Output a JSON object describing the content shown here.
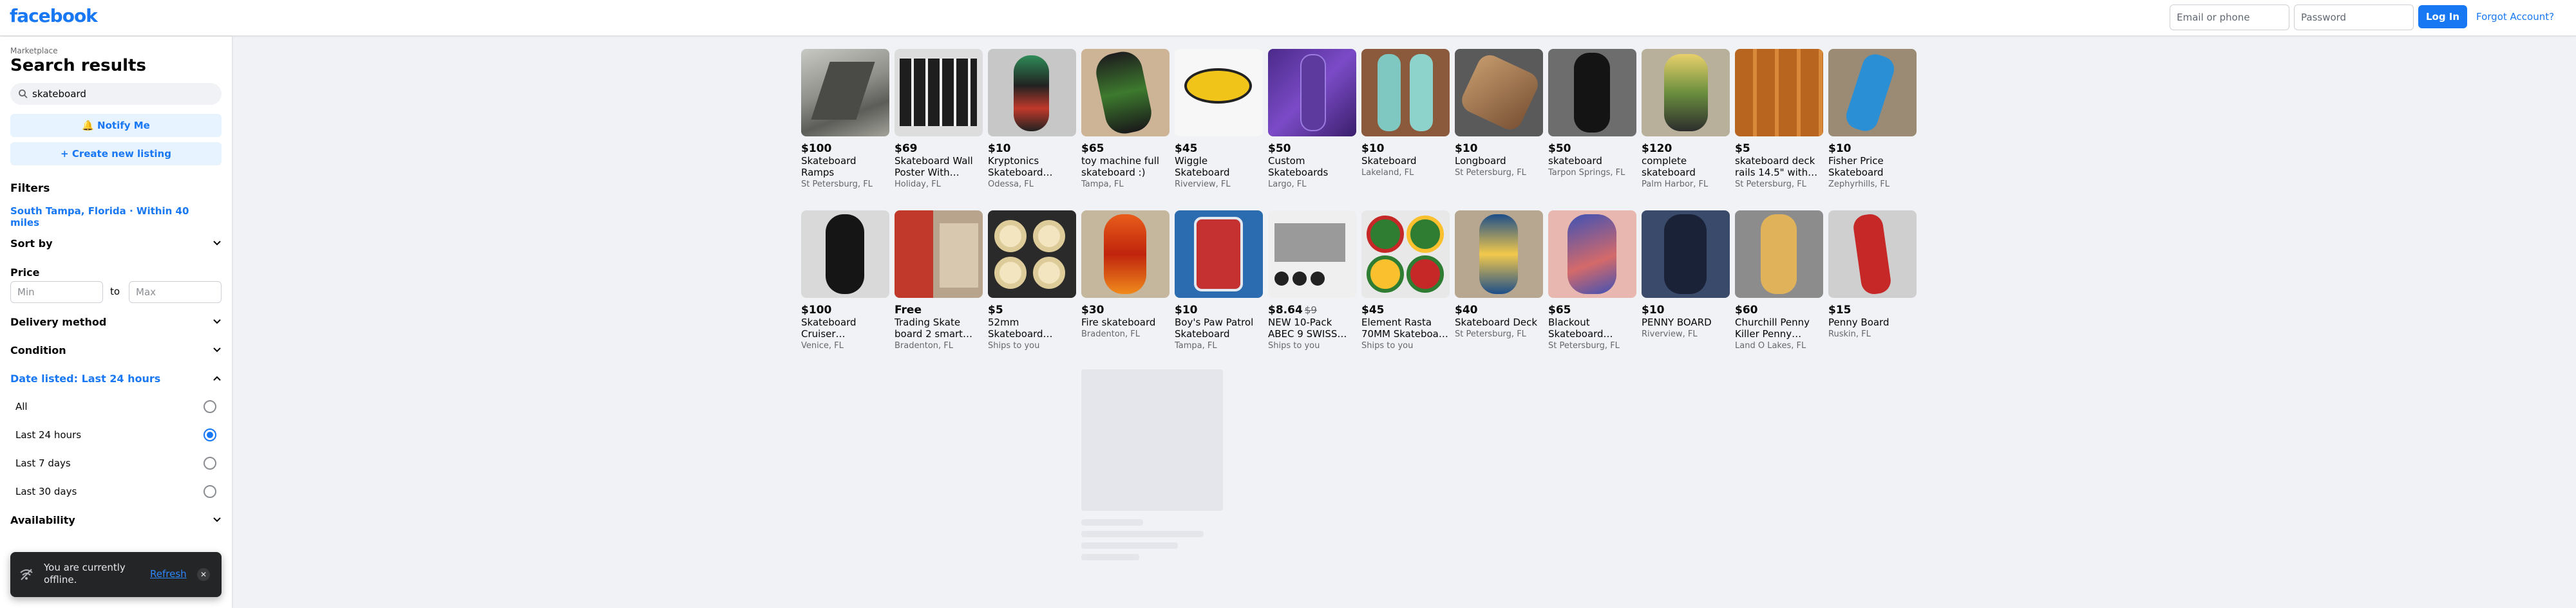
{
  "header": {
    "logo": "facebook",
    "email_placeholder": "Email or phone",
    "password_placeholder": "Password",
    "login_label": "Log In",
    "forgot_label": "Forgot Account?"
  },
  "sidebar": {
    "breadcrumb": "Marketplace",
    "title": "Search results",
    "search_value": "skateboard",
    "notify_label": "🔔 Notify Me",
    "create_label": "+ Create new listing",
    "filters_label": "Filters",
    "location": "South Tampa, Florida · Within 40 miles",
    "sort_label": "Sort by",
    "price_label": "Price",
    "min_placeholder": "Min",
    "to_label": "to",
    "max_placeholder": "Max",
    "delivery_label": "Delivery method",
    "condition_label": "Condition",
    "date_label": "Date listed: Last 24 hours",
    "date_options": [
      {
        "label": "All",
        "selected": false
      },
      {
        "label": "Last 24 hours",
        "selected": true
      },
      {
        "label": "Last 7 days",
        "selected": false
      },
      {
        "label": "Last 30 days",
        "selected": false
      }
    ],
    "availability_label": "Availability",
    "toast_message": "You are currently offline.",
    "toast_refresh": "Refresh",
    "toast_close": "✕"
  },
  "listings": [
    {
      "price": "$100",
      "name": "Skateboard Ramps",
      "location": "St Petersburg, FL"
    },
    {
      "price": "$69",
      "name": "Skateboard Wall Poster With…",
      "location": "Holiday, FL"
    },
    {
      "price": "$10",
      "name": "Kryptonics Skateboard…",
      "location": "Odessa, FL"
    },
    {
      "price": "$65",
      "name": "toy machine full skateboard :)",
      "location": "Tampa, FL"
    },
    {
      "price": "$45",
      "name": "Wiggle Skateboard",
      "location": "Riverview, FL"
    },
    {
      "price": "$50",
      "name": "Custom Skateboards",
      "location": "Largo, FL"
    },
    {
      "price": "$10",
      "name": "Skateboard",
      "location": "Lakeland, FL"
    },
    {
      "price": "$10",
      "name": "Longboard",
      "location": "St Petersburg, FL"
    },
    {
      "price": "$50",
      "name": "skateboard",
      "location": "Tarpon Springs, FL"
    },
    {
      "price": "$120",
      "name": "complete skateboard",
      "location": "Palm Harbor, FL"
    },
    {
      "price": "$5",
      "name": "skateboard deck rails 14.5\" with…",
      "location": "St Petersburg, FL"
    },
    {
      "price": "$10",
      "name": "Fisher Price Skateboard",
      "location": "Zephyrhills, FL"
    },
    {
      "price": "$100",
      "name": "Skateboard Cruiser…",
      "location": "Venice, FL"
    },
    {
      "price": "Free",
      "name": "Trading Skate board 2 smart…",
      "location": "Bradenton, FL"
    },
    {
      "price": "$5",
      "name": "52mm Skateboard…",
      "location": "Ships to you"
    },
    {
      "price": "$30",
      "name": "Fire skateboard",
      "location": "Bradenton, FL"
    },
    {
      "price": "$10",
      "name": "Boy's Paw Patrol Skateboard",
      "location": "Tampa, FL"
    },
    {
      "price": "$8.64",
      "old_price": "$9",
      "name": "NEW 10-Pack ABEC 9 SWISS…",
      "location": "Ships to you"
    },
    {
      "price": "$45",
      "name": "Element Rasta 70MM Skateboa…",
      "location": "Ships to you"
    },
    {
      "price": "$40",
      "name": "Skateboard Deck",
      "location": "St Petersburg, FL"
    },
    {
      "price": "$65",
      "name": "Blackout Skateboard…",
      "location": "St Petersburg, FL"
    },
    {
      "price": "$10",
      "name": "PENNY BOARD",
      "location": "Riverview, FL"
    },
    {
      "price": "$60",
      "name": "Churchill Penny Killer Penny…",
      "location": "Land O Lakes, FL"
    },
    {
      "price": "$15",
      "name": "Penny Board",
      "location": "Ruskin, FL"
    }
  ],
  "colors": {
    "brand": "#1877f2",
    "background": "#f0f2f5",
    "placeholder": "#e4e6eb"
  }
}
